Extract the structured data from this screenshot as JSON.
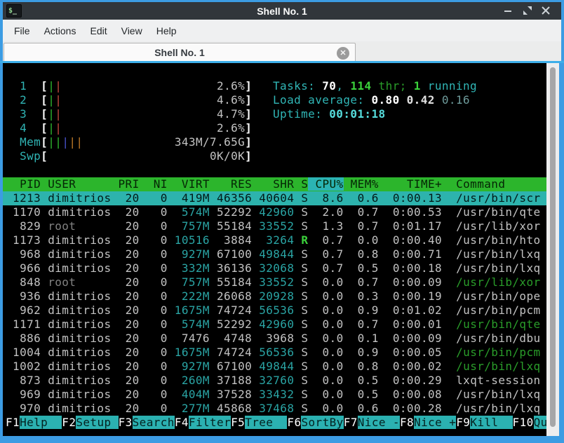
{
  "window": {
    "title": "Shell No. 1",
    "controls": {
      "minimize": "minimize",
      "restore": "restore",
      "close": "close"
    }
  },
  "menu": {
    "items": [
      "File",
      "Actions",
      "Edit",
      "View",
      "Help"
    ]
  },
  "tab": {
    "label": "Shell No. 1",
    "close": "close-tab"
  },
  "htop": {
    "meters": [
      {
        "label": "1",
        "bars": [
          "green",
          "red"
        ],
        "value": "2.6%"
      },
      {
        "label": "2",
        "bars": [
          "green",
          "red"
        ],
        "value": "4.6%"
      },
      {
        "label": "3",
        "bars": [
          "green",
          "red"
        ],
        "value": "4.7%"
      },
      {
        "label": "4",
        "bars": [
          "green",
          "red"
        ],
        "value": "2.6%"
      },
      {
        "label": "Mem",
        "bars": [
          "green",
          "green",
          "blue",
          "orange",
          "orange"
        ],
        "value": "343M/7.65G"
      },
      {
        "label": "Swp",
        "bars": [],
        "value": "0K/0K"
      }
    ],
    "summary": {
      "tasks": {
        "label": "Tasks: ",
        "count": "70",
        "sep": ", ",
        "threads": "114",
        "thr_label": " thr; ",
        "running": "1",
        "running_label": " running"
      },
      "load": {
        "label": "Load average: ",
        "one": "0.80",
        "five": "0.42",
        "fifteen": "0.16"
      },
      "uptime": {
        "label": "Uptime: ",
        "value": "00:01:18"
      }
    },
    "columns": [
      "PID",
      "USER",
      "PRI",
      "NI",
      "VIRT",
      "RES",
      "SHR",
      "S",
      "CPU%",
      "MEM%",
      "TIME+",
      "Command"
    ],
    "sort_column": "CPU%",
    "processes": [
      {
        "pid": "1213",
        "user": "dimitrios",
        "pri": "20",
        "ni": "0",
        "virt": "419M",
        "res": "46356",
        "shr": "40604",
        "s": "S",
        "cpu": "8.6",
        "mem": "0.6",
        "time": "0:00.13",
        "command": "/usr/bin/scr",
        "selected": true,
        "thread": false,
        "virt_hl": true,
        "shr_hl": true
      },
      {
        "pid": "1170",
        "user": "dimitrios",
        "pri": "20",
        "ni": "0",
        "virt": "574M",
        "res": "52292",
        "shr": "42960",
        "s": "S",
        "cpu": "2.0",
        "mem": "0.7",
        "time": "0:00.53",
        "command": "/usr/bin/qte",
        "selected": false,
        "thread": false,
        "virt_hl": true,
        "shr_hl": true
      },
      {
        "pid": "829",
        "user": "root",
        "pri": "20",
        "ni": "0",
        "virt": "757M",
        "res": "55184",
        "shr": "33552",
        "s": "S",
        "cpu": "1.3",
        "mem": "0.7",
        "time": "0:01.17",
        "command": "/usr/lib/xor",
        "selected": false,
        "thread": false,
        "virt_hl": true,
        "shr_hl": true
      },
      {
        "pid": "1173",
        "user": "dimitrios",
        "pri": "20",
        "ni": "0",
        "virt": "10516",
        "res": "3884",
        "shr": "3264",
        "s": "R",
        "cpu": "0.7",
        "mem": "0.0",
        "time": "0:00.40",
        "command": "/usr/bin/hto",
        "selected": false,
        "thread": false,
        "virt_hl": true,
        "shr_hl": true
      },
      {
        "pid": "968",
        "user": "dimitrios",
        "pri": "20",
        "ni": "0",
        "virt": "927M",
        "res": "67100",
        "shr": "49844",
        "s": "S",
        "cpu": "0.7",
        "mem": "0.8",
        "time": "0:00.71",
        "command": "/usr/bin/lxq",
        "selected": false,
        "thread": false,
        "virt_hl": true,
        "shr_hl": true
      },
      {
        "pid": "966",
        "user": "dimitrios",
        "pri": "20",
        "ni": "0",
        "virt": "332M",
        "res": "36136",
        "shr": "32068",
        "s": "S",
        "cpu": "0.7",
        "mem": "0.5",
        "time": "0:00.18",
        "command": "/usr/bin/lxq",
        "selected": false,
        "thread": false,
        "virt_hl": true,
        "shr_hl": true
      },
      {
        "pid": "848",
        "user": "root",
        "pri": "20",
        "ni": "0",
        "virt": "757M",
        "res": "55184",
        "shr": "33552",
        "s": "S",
        "cpu": "0.0",
        "mem": "0.7",
        "time": "0:00.09",
        "command": "/usr/lib/xor",
        "selected": false,
        "thread": true,
        "virt_hl": true,
        "shr_hl": true
      },
      {
        "pid": "936",
        "user": "dimitrios",
        "pri": "20",
        "ni": "0",
        "virt": "222M",
        "res": "26068",
        "shr": "20928",
        "s": "S",
        "cpu": "0.0",
        "mem": "0.3",
        "time": "0:00.19",
        "command": "/usr/bin/ope",
        "selected": false,
        "thread": false,
        "virt_hl": true,
        "shr_hl": true
      },
      {
        "pid": "962",
        "user": "dimitrios",
        "pri": "20",
        "ni": "0",
        "virt": "1675M",
        "res": "74724",
        "shr": "56536",
        "s": "S",
        "cpu": "0.0",
        "mem": "0.9",
        "time": "0:01.02",
        "command": "/usr/bin/pcm",
        "selected": false,
        "thread": false,
        "virt_hl": true,
        "shr_hl": true
      },
      {
        "pid": "1171",
        "user": "dimitrios",
        "pri": "20",
        "ni": "0",
        "virt": "574M",
        "res": "52292",
        "shr": "42960",
        "s": "S",
        "cpu": "0.0",
        "mem": "0.7",
        "time": "0:00.01",
        "command": "/usr/bin/qte",
        "selected": false,
        "thread": true,
        "virt_hl": true,
        "shr_hl": true
      },
      {
        "pid": "886",
        "user": "dimitrios",
        "pri": "20",
        "ni": "0",
        "virt": "7476",
        "res": "4748",
        "shr": "3968",
        "s": "S",
        "cpu": "0.0",
        "mem": "0.1",
        "time": "0:00.09",
        "command": "/usr/bin/dbu",
        "selected": false,
        "thread": false,
        "virt_hl": false,
        "shr_hl": false
      },
      {
        "pid": "1004",
        "user": "dimitrios",
        "pri": "20",
        "ni": "0",
        "virt": "1675M",
        "res": "74724",
        "shr": "56536",
        "s": "S",
        "cpu": "0.0",
        "mem": "0.9",
        "time": "0:00.05",
        "command": "/usr/bin/pcm",
        "selected": false,
        "thread": true,
        "virt_hl": true,
        "shr_hl": true
      },
      {
        "pid": "1002",
        "user": "dimitrios",
        "pri": "20",
        "ni": "0",
        "virt": "927M",
        "res": "67100",
        "shr": "49844",
        "s": "S",
        "cpu": "0.0",
        "mem": "0.8",
        "time": "0:00.02",
        "command": "/usr/bin/lxq",
        "selected": false,
        "thread": true,
        "virt_hl": true,
        "shr_hl": true
      },
      {
        "pid": "873",
        "user": "dimitrios",
        "pri": "20",
        "ni": "0",
        "virt": "260M",
        "res": "37188",
        "shr": "32760",
        "s": "S",
        "cpu": "0.0",
        "mem": "0.5",
        "time": "0:00.29",
        "command": "lxqt-session",
        "selected": false,
        "thread": false,
        "virt_hl": true,
        "shr_hl": true
      },
      {
        "pid": "969",
        "user": "dimitrios",
        "pri": "20",
        "ni": "0",
        "virt": "404M",
        "res": "37528",
        "shr": "33432",
        "s": "S",
        "cpu": "0.0",
        "mem": "0.5",
        "time": "0:00.08",
        "command": "/usr/bin/lxq",
        "selected": false,
        "thread": false,
        "virt_hl": true,
        "shr_hl": true
      },
      {
        "pid": "970",
        "user": "dimitrios",
        "pri": "20",
        "ni": "0",
        "virt": "277M",
        "res": "45868",
        "shr": "37468",
        "s": "S",
        "cpu": "0.0",
        "mem": "0.6",
        "time": "0:00.28",
        "command": "/usr/bin/lxq",
        "selected": false,
        "thread": false,
        "virt_hl": true,
        "shr_hl": true
      }
    ],
    "fkeys": [
      {
        "key": "F1",
        "label": "Help  "
      },
      {
        "key": "F2",
        "label": "Setup "
      },
      {
        "key": "F3",
        "label": "Search"
      },
      {
        "key": "F4",
        "label": "Filter"
      },
      {
        "key": "F5",
        "label": "Tree  "
      },
      {
        "key": "F6",
        "label": "SortBy"
      },
      {
        "key": "F7",
        "label": "Nice -"
      },
      {
        "key": "F8",
        "label": "Nice +"
      },
      {
        "key": "F9",
        "label": "Kill  "
      },
      {
        "key": "F10",
        "label": "Qu"
      }
    ]
  },
  "colors": {
    "accent_blue": "#3c9ce3",
    "highlight": "#3daee9",
    "titlebar_bg": "#31363b",
    "menubar_bg": "#eff0f1",
    "terminal_bg": "#000000",
    "header_green": "#2cb52c",
    "selection_cyan": "#2db3ad",
    "sort_cyan": "#2bb3b3",
    "fkey_cyan": "#2bb1b1",
    "text_gray": "#c2c2c2",
    "text_dim": "#818181",
    "value_teal": "#2aa4a4",
    "cyan_label": "#30b5b5",
    "cyan_bright": "#55dcdc",
    "green_bright": "#3bd23b",
    "green_dim": "#2a9d2a",
    "white": "#ffffff",
    "bar_green": "#2eb82e",
    "bar_red": "#c4493d",
    "bar_blue": "#4953cf",
    "bar_orange": "#c07a28",
    "scroll_track": "#ededee",
    "scroll_handle": "#a6a6a8"
  }
}
